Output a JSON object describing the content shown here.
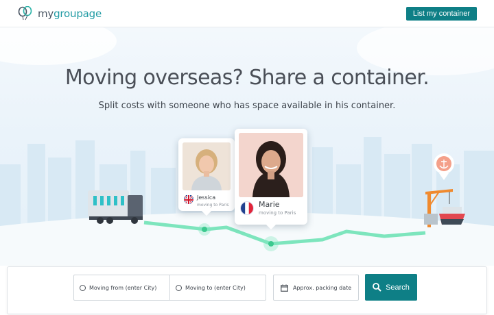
{
  "brand": {
    "name_prefix": "my",
    "name_suffix": "groupage"
  },
  "header": {
    "cta_label": "List my container"
  },
  "hero": {
    "title": "Moving overseas? Share a container.",
    "subtitle": "Split costs with someone who has space available in his container."
  },
  "profiles": [
    {
      "name": "Jessica",
      "destination": "moving to Paris",
      "flag": "uk-flag-icon"
    },
    {
      "name": "Marie",
      "destination": "moving to Paris",
      "flag": "france-flag-icon"
    }
  ],
  "search": {
    "from_placeholder": "Moving from (enter City)",
    "to_placeholder": "Moving to (enter City)",
    "date_placeholder": "Approx. packing date",
    "button_label": "Search"
  },
  "colors": {
    "accent": "#0e7f86",
    "route": "#6fe0b6"
  }
}
